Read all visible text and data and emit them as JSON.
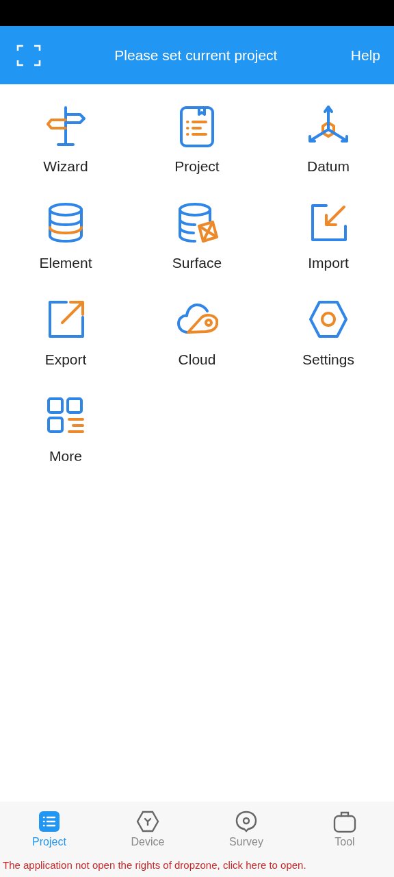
{
  "header": {
    "title": "Please set current project",
    "help": "Help"
  },
  "tiles": [
    {
      "label": "Wizard",
      "kind": "signpost"
    },
    {
      "label": "Project",
      "kind": "document"
    },
    {
      "label": "Datum",
      "kind": "axes"
    },
    {
      "label": "Element",
      "kind": "database"
    },
    {
      "label": "Surface",
      "kind": "surface"
    },
    {
      "label": "Import",
      "kind": "import"
    },
    {
      "label": "Export",
      "kind": "export"
    },
    {
      "label": "Cloud",
      "kind": "cloud"
    },
    {
      "label": "Settings",
      "kind": "hexagon"
    },
    {
      "label": "More",
      "kind": "grid"
    }
  ],
  "tabs": [
    {
      "label": "Project",
      "kind": "list",
      "selected": true
    },
    {
      "label": "Device",
      "kind": "device",
      "selected": false
    },
    {
      "label": "Survey",
      "kind": "pin",
      "selected": false
    },
    {
      "label": "Tool",
      "kind": "case",
      "selected": false
    }
  ],
  "notice": "The application not open the rights of dropzone, click here to open."
}
